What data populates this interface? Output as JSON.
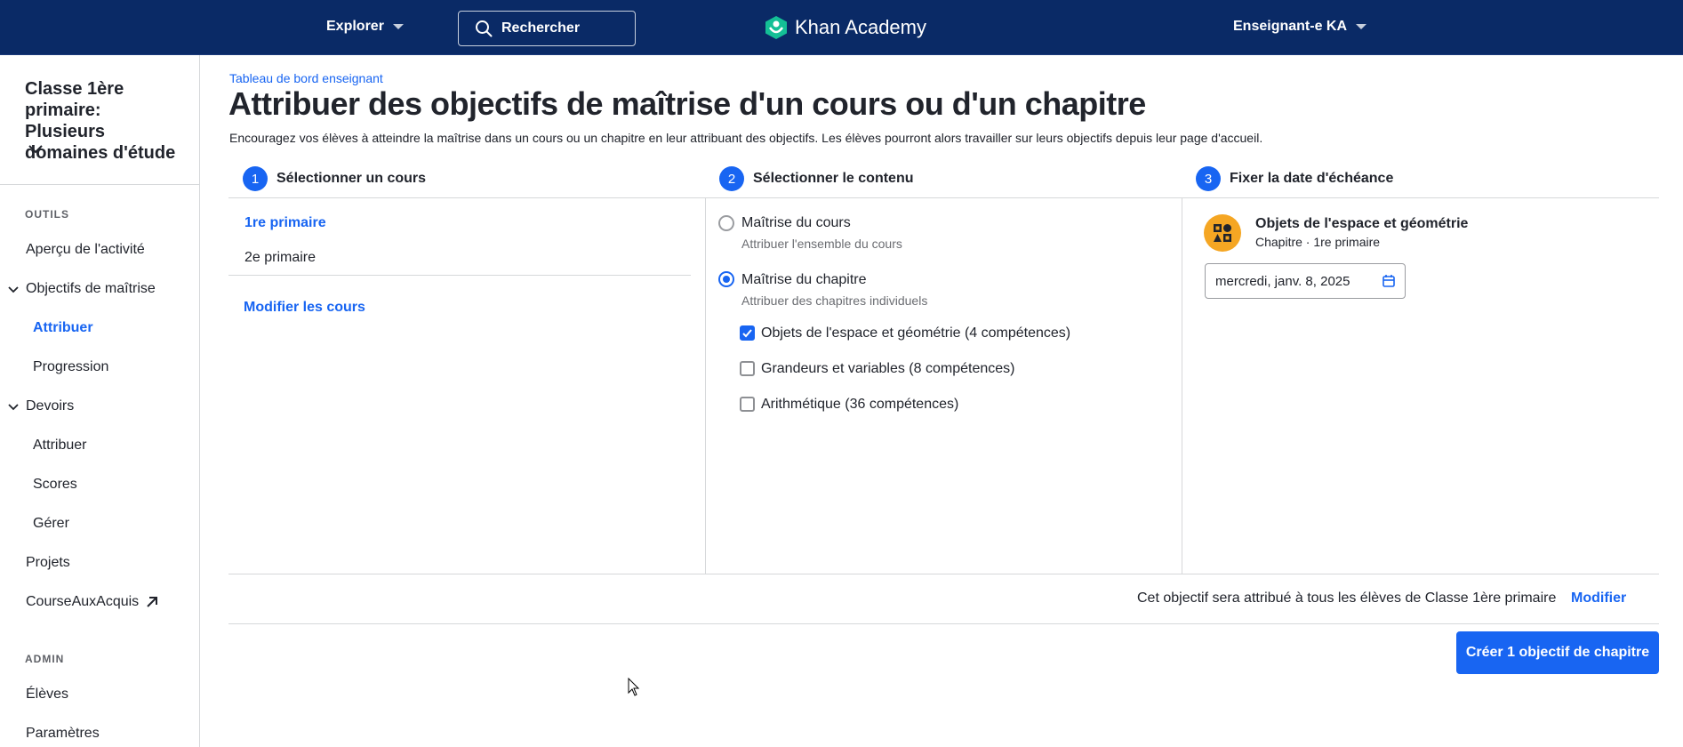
{
  "topbar": {
    "explore_label": "Explorer",
    "search_label": "Rechercher",
    "logo_text": "Khan Academy",
    "user_label": "Enseignant-e KA"
  },
  "sidebar": {
    "class_name": "Classe 1ère primaire: Plusieurs domaines d'étude",
    "tools_label": "OUTILS",
    "items": [
      {
        "label": "Aperçu de l'activité"
      },
      {
        "label": "Objectifs de maîtrise"
      },
      {
        "label": "Attribuer"
      },
      {
        "label": "Progression"
      },
      {
        "label": "Devoirs"
      },
      {
        "label": "Attribuer"
      },
      {
        "label": "Scores"
      },
      {
        "label": "Gérer"
      },
      {
        "label": "Projets"
      },
      {
        "label": "CourseAuxAcquis"
      }
    ],
    "admin_label": "ADMIN",
    "admin_items": [
      {
        "label": "Élèves"
      },
      {
        "label": "Paramètres"
      }
    ]
  },
  "main": {
    "breadcrumb": "Tableau de bord enseignant",
    "title": "Attribuer des objectifs de maîtrise d'un cours ou d'un chapitre",
    "description": "Encouragez vos élèves à atteindre la maîtrise dans un cours ou un chapitre en leur attribuant des objectifs. Les élèves pourront alors travailler sur leurs objectifs depuis leur page d'accueil.",
    "steps": [
      {
        "num": "1",
        "label": "Sélectionner un cours"
      },
      {
        "num": "2",
        "label": "Sélectionner le contenu"
      },
      {
        "num": "3",
        "label": "Fixer la date d'échéance"
      }
    ],
    "courses": [
      "1re primaire",
      "2e primaire"
    ],
    "edit_courses": "Modifier les cours",
    "options": [
      {
        "title": "Maîtrise du cours",
        "sub": "Attribuer l'ensemble du cours"
      },
      {
        "title": "Maîtrise du chapitre",
        "sub": "Attribuer des chapitres individuels"
      }
    ],
    "chapters": [
      {
        "label": "Objets de l'espace et géométrie (4 compétences)",
        "checked": true
      },
      {
        "label": "Grandeurs et variables (8 compétences)",
        "checked": false
      },
      {
        "label": "Arithmétique (36 compétences)",
        "checked": false
      }
    ],
    "due": {
      "chapter_title": "Objets de l'espace et géométrie",
      "chapter_sub": "Chapitre · 1re primaire",
      "date_value": "mercredi, janv. 8, 2025"
    },
    "footer": {
      "note": "Cet objectif sera attribué à tous les élèves de Classe 1ère primaire",
      "modify": "Modifier",
      "create_button": "Créer 1 objectif de chapitre"
    }
  },
  "colors": {
    "topbar": "#0a2a66",
    "accent": "#1865f2",
    "chapter_icon": "#f5a623"
  }
}
